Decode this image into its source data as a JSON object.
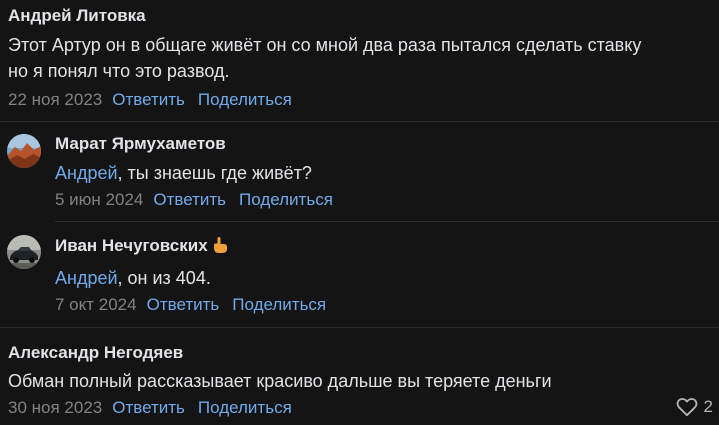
{
  "comments": [
    {
      "author": "Андрей Литовка",
      "text_lines": [
        "Этот Артур он в общаге живёт он со мной два раза пытался сделать ставку",
        "но я понял что это развод."
      ],
      "date": "22 ноя 2023",
      "reply": "Ответить",
      "share": "Поделиться"
    },
    {
      "author": "Марат Ярмухаметов",
      "mention": "Андрей",
      "text": ", ты знаешь где живёт?",
      "date": "5 июн 2024",
      "reply": "Ответить",
      "share": "Поделиться",
      "avatar_icon": "landscape-avatar"
    },
    {
      "author": "Иван Нечуговских",
      "author_emoji_icon": "hand-pointing-icon",
      "mention": "Андрей",
      "text": ", он из 404.",
      "date": "7 окт 2024",
      "reply": "Ответить",
      "share": "Поделиться",
      "avatar_icon": "car-avatar"
    },
    {
      "author": "Александр Негодяев",
      "text": "Обман полный рассказывает красиво дальше вы теряете деньги",
      "date": "30 ноя 2023",
      "reply": "Ответить",
      "share": "Поделиться",
      "likes": "2",
      "like_icon": "heart-outline-icon"
    }
  ],
  "colors": {
    "background": "#141414",
    "text": "#e1e3e6",
    "accent": "#71aaeb",
    "muted": "#828282"
  }
}
